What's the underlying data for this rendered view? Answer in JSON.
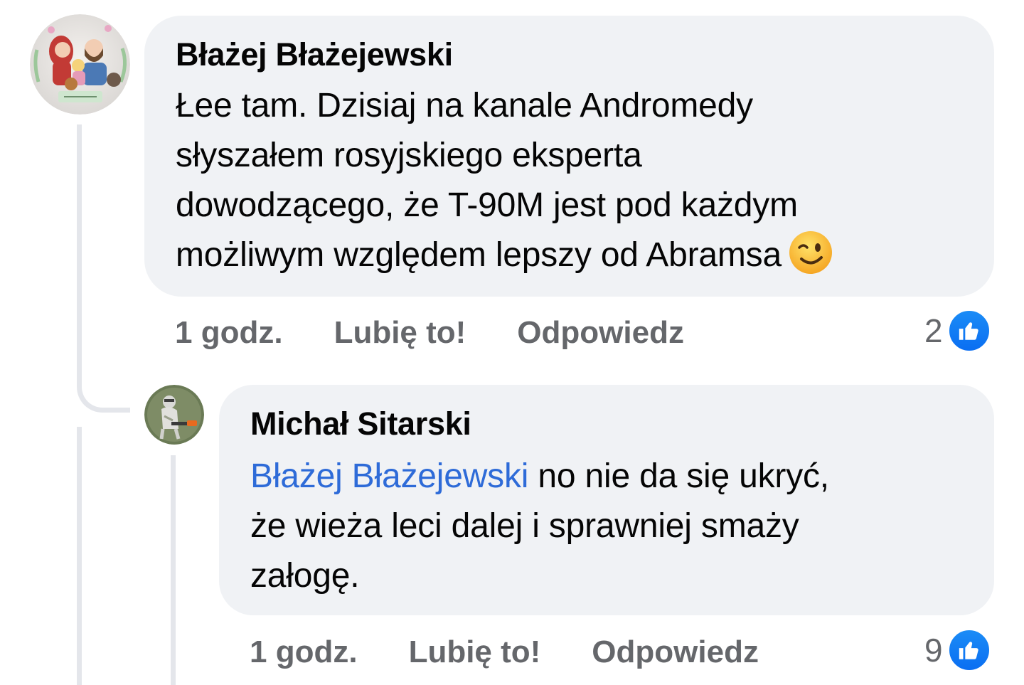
{
  "comments": [
    {
      "author": "Błażej Błażejewski",
      "avatar_icon": "family-drawing-avatar",
      "text_lines": [
        "Łee tam. Dzisiaj na kanale Andromedy",
        "słyszałem rosyjskiego eksperta",
        "dowodzącego, że T-90M jest pod każdym",
        "możliwym względem lepszy od Abramsa"
      ],
      "emoji_icon": "winking-face-emoji",
      "time": "1 godz.",
      "like_label": "Lubię to!",
      "reply_label": "Odpowiedz",
      "reaction_count": "2"
    },
    {
      "author": "Michał Sitarski",
      "avatar_icon": "soldier-avatar",
      "mention": "Błażej Błażejewski",
      "text_first": " no nie da się ukryć,",
      "text_lines": [
        "że wieża leci dalej i sprawniej smaży",
        "załogę."
      ],
      "time": "1 godz.",
      "like_label": "Lubię to!",
      "reply_label": "Odpowiedz",
      "reaction_count": "9"
    }
  ],
  "colors": {
    "bubble": "#f0f2f5",
    "mention": "#2e6bd8",
    "meta": "#65676b",
    "like_badge": "#1877f2",
    "thread_line": "#e4e6eb"
  }
}
